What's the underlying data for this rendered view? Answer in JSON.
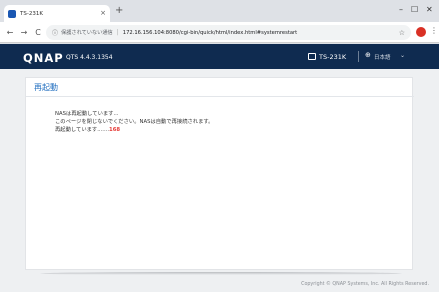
{
  "browser": {
    "tab_title": "TS-231K",
    "tab_close": "×",
    "new_tab": "+",
    "win_minimize": "–",
    "win_maximize": "☐",
    "win_close": "✕",
    "back": "←",
    "forward": "→",
    "reload": "C",
    "info": "ⓘ",
    "not_secure": "保護されていない通信",
    "url": "172.16.156.104:8080/cgi-bin/quick/html/index.html#systemrestart",
    "star": "☆",
    "menu": "⋮"
  },
  "header": {
    "logo": "QNAP",
    "version": "QTS 4.4.3.1354",
    "device_name": "TS-231K",
    "language": "日本語",
    "lang_chevron": "⌄",
    "lang_icon": "⊕"
  },
  "restart": {
    "title": "再起動",
    "line1": "NASは再起動しています...",
    "line2": "このページを閉じないでください。NASは自動で再接続されます。",
    "line3_prefix": "再起動しています.......",
    "countdown": "168"
  },
  "footer": {
    "copyright": "Copyright © QNAP Systems, Inc. All Rights Reserved."
  },
  "colors": {
    "header_bg": "#0f2b50",
    "title_blue": "#1f6dbf",
    "countdown_red": "#e53935"
  }
}
